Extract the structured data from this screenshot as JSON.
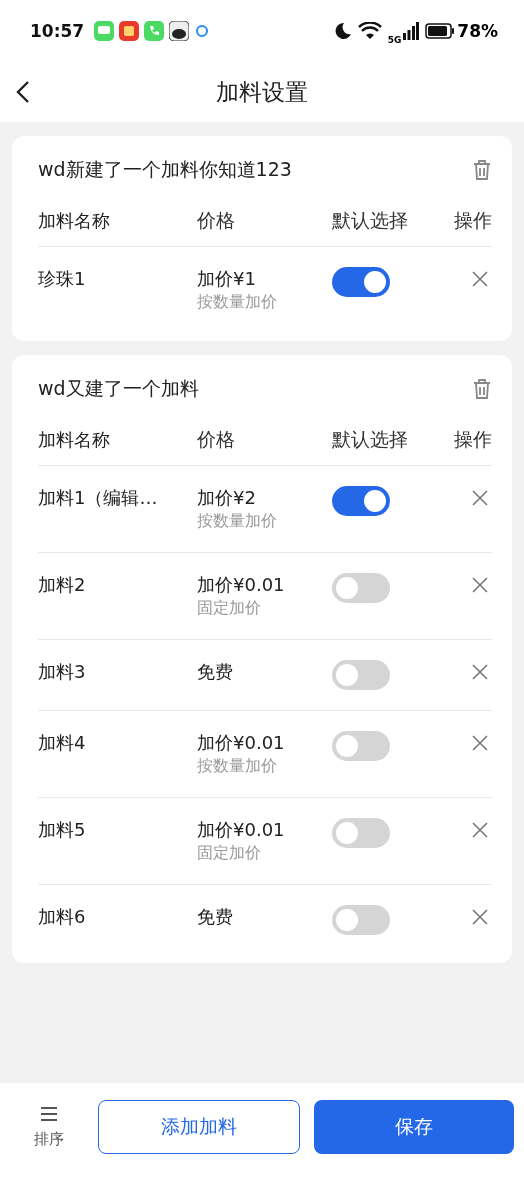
{
  "status_bar": {
    "time": "10:57",
    "network": "5G",
    "battery": "78%"
  },
  "header": {
    "title": "加料设置"
  },
  "groups": [
    {
      "title": "wd新建了一个加料你知道123",
      "columns": [
        "加料名称",
        "价格",
        "默认选择",
        "操作"
      ],
      "items": [
        {
          "name": "珍珠1",
          "price": "加价¥1",
          "pricing": "按数量加价",
          "on": true
        }
      ]
    },
    {
      "title": "wd又建了一个加料",
      "columns": [
        "加料名称",
        "价格",
        "默认选择",
        "操作"
      ],
      "items": [
        {
          "name": "加料1（编辑…",
          "price": "加价¥2",
          "pricing": "按数量加价",
          "on": true
        },
        {
          "name": "加料2",
          "price": "加价¥0.01",
          "pricing": "固定加价",
          "on": false
        },
        {
          "name": "加料3",
          "price": "免费",
          "on": false
        },
        {
          "name": "加料4",
          "price": "加价¥0.01",
          "pricing": "按数量加价",
          "on": false
        },
        {
          "name": "加料5",
          "price": "加价¥0.01",
          "pricing": "固定加价",
          "on": false
        },
        {
          "name": "加料6",
          "price": "免费",
          "on": false
        }
      ]
    }
  ],
  "footer": {
    "sort_label": "排序",
    "add_button": "添加加料",
    "save_button": "保存"
  }
}
